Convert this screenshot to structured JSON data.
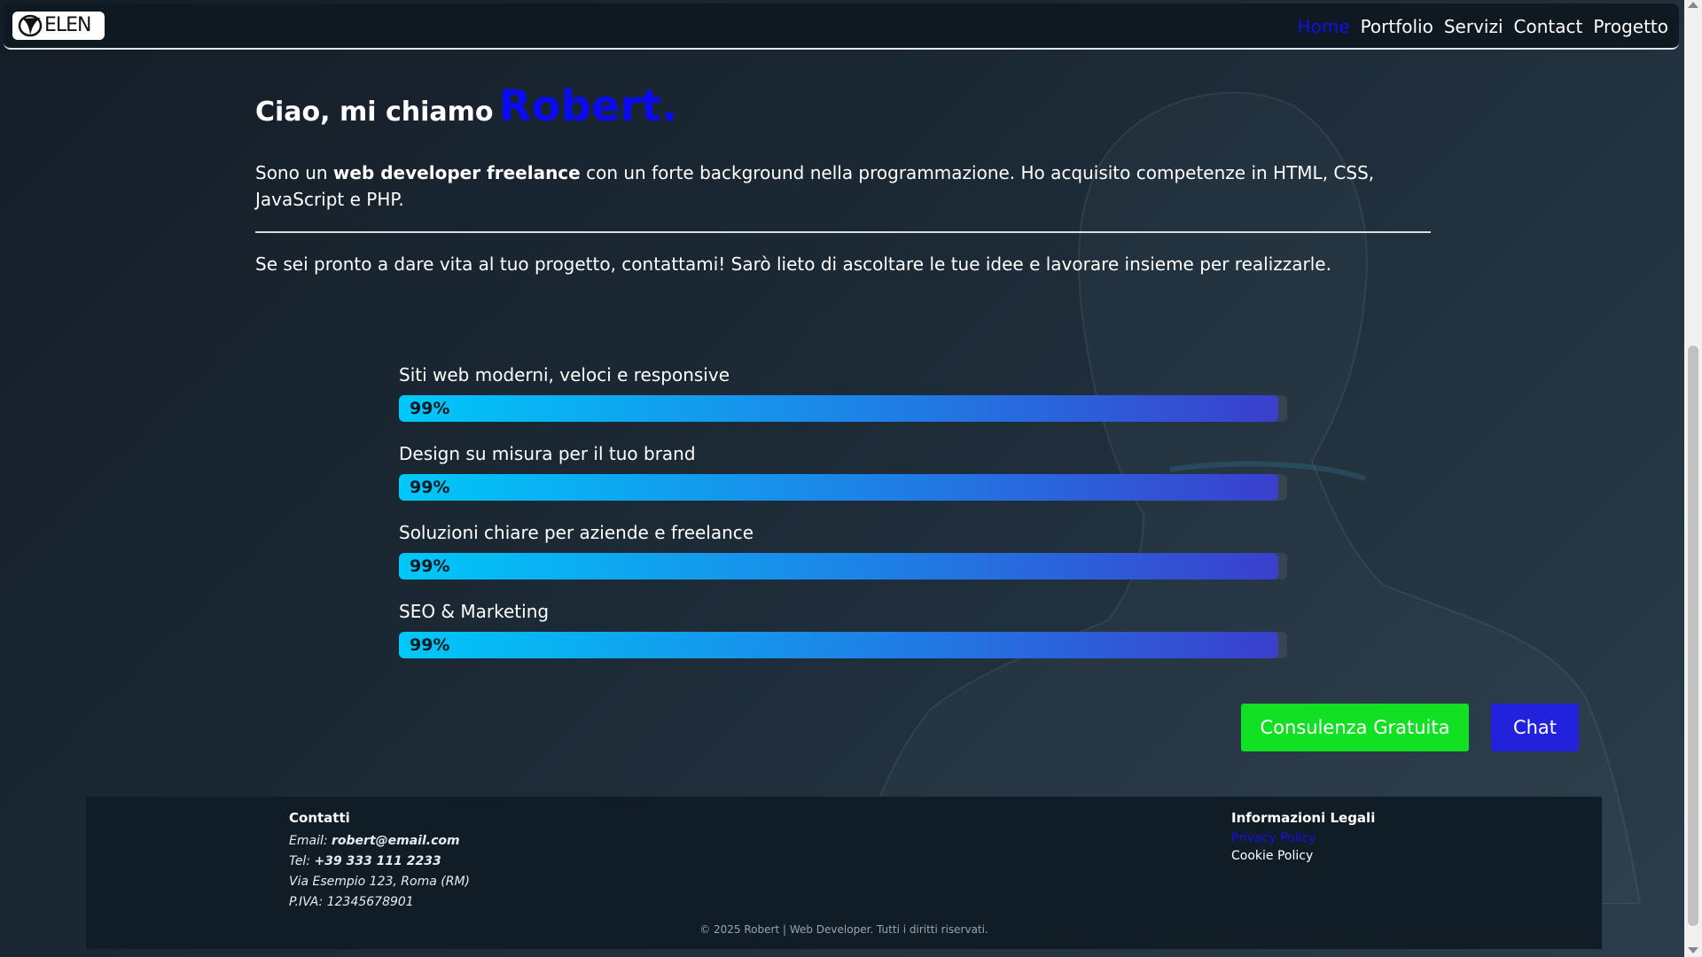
{
  "brand": {
    "logo_text": "ELEN"
  },
  "nav": {
    "items": [
      "Home",
      "Portfolio",
      "Servizi",
      "Contact",
      "Progetto"
    ],
    "active": "Home"
  },
  "hero": {
    "greeting": "Ciao, mi chiamo",
    "name": "Robert.",
    "intro_prefix": "Sono un ",
    "intro_bold": "web developer freelance",
    "intro_suffix": " con un forte background nella programmazione. Ho acquisito competenze in HTML, CSS, JavaScript e PHP.",
    "cta": "Se sei pronto a dare vita al tuo progetto, contattami! Sarò lieto di ascoltare le tue idee e lavorare insieme per realizzarle."
  },
  "skills": [
    {
      "label": "Siti web moderni, veloci e responsive",
      "value_text": "99%",
      "value": 99
    },
    {
      "label": "Design su misura per il tuo brand",
      "value_text": "99%",
      "value": 99
    },
    {
      "label": "Soluzioni chiare per aziende e freelance",
      "value_text": "99%",
      "value": 99
    },
    {
      "label": "SEO & Marketing",
      "value_text": "99%",
      "value": 99
    }
  ],
  "buttons": {
    "consult": "Consulenza Gratuita",
    "chat": "Chat"
  },
  "footer": {
    "contacts_title": "Contatti",
    "email_label": "Email: ",
    "email": "robert@email.com",
    "tel_label": "Tel: ",
    "tel": "+39 333 111 2233",
    "address": "Via Esempio 123, Roma (RM)",
    "vat": "P.IVA: 12345678901",
    "legal_title": "Informazioni Legali",
    "privacy": "Privacy Policy",
    "cookie": "Cookie Policy",
    "copyright": "© 2025 Robert | Web Developer. Tutti i diritti riservati."
  },
  "colors": {
    "accent_blue": "#0b0bef",
    "consult_green": "#12e022",
    "chat_blue": "#2222dc"
  }
}
